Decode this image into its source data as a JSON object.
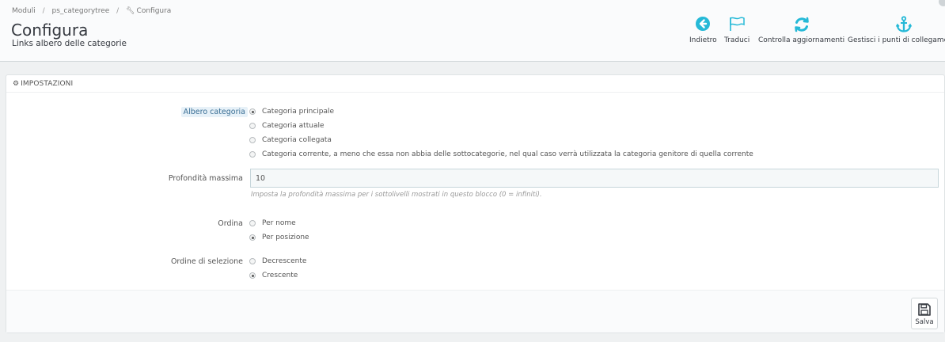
{
  "breadcrumb": {
    "items": [
      "Moduli",
      "ps_categorytree",
      "Configura"
    ],
    "separator": "/"
  },
  "header": {
    "title": "Configura",
    "subtitle": "Links albero delle categorie"
  },
  "toolbar": {
    "back_label": "Indietro",
    "translate_label": "Traduci",
    "check_updates_label": "Controlla aggiornamenti",
    "hooks_label": "Gestisci i punti di collegamento",
    "accent_color": "#25b9d7"
  },
  "panel": {
    "heading": "IMPOSTAZIONI",
    "heading_icon": "gears-icon"
  },
  "form": {
    "category_root": {
      "label": "Albero categoria",
      "options": [
        {
          "label": "Categoria principale",
          "checked": true
        },
        {
          "label": "Categoria attuale",
          "checked": false
        },
        {
          "label": "Categoria collegata",
          "checked": false
        },
        {
          "label": "Categoria corrente, a meno che essa non abbia delle sottocategorie, nel qual caso verrà utilizzata la categoria genitore di quella corrente",
          "checked": false
        }
      ]
    },
    "max_depth": {
      "label": "Profondità massima",
      "value": "10",
      "help": "Imposta la profondità massima per i sottolivelli mostrati in questo blocco (0 = infiniti)."
    },
    "sort": {
      "label": "Ordina",
      "options": [
        {
          "label": "Per nome",
          "checked": false
        },
        {
          "label": "Per posizione",
          "checked": true
        }
      ]
    },
    "sort_order": {
      "label": "Ordine di selezione",
      "options": [
        {
          "label": "Decrescente",
          "checked": false
        },
        {
          "label": "Crescente",
          "checked": true
        }
      ]
    }
  },
  "footer": {
    "save_label": "Salva"
  }
}
